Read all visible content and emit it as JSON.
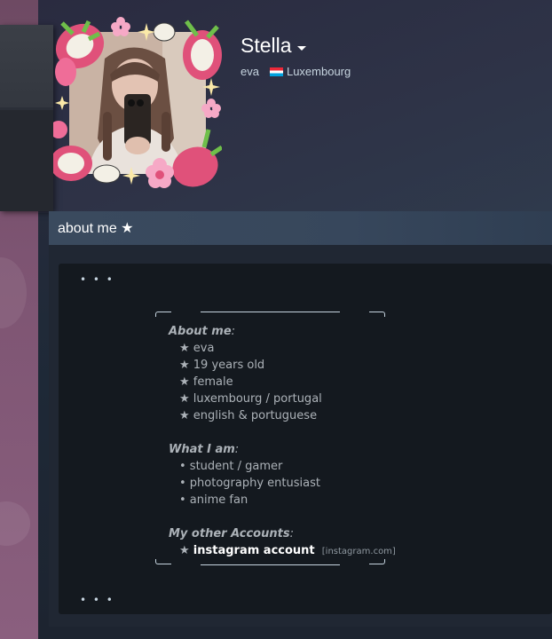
{
  "profile": {
    "name": "Stella",
    "real_name": "eva",
    "country": "Luxembourg",
    "country_flag_colors": [
      "#ed2939",
      "#ffffff",
      "#00a1de"
    ]
  },
  "about_section": {
    "title": "about me ★",
    "top_dots": "• • •",
    "bottom_dots": "• • •",
    "about_heading": "About me",
    "about_items": [
      "★ eva",
      "★ 19 years old",
      "★ female",
      "★ luxembourg / portugal",
      "★ english & portuguese"
    ],
    "what_heading": "What I am",
    "what_items": [
      "• student / gamer",
      "• photography entusiast",
      "• anime fan"
    ],
    "accounts_heading": "My other Accounts",
    "account_star": "★",
    "account_link": "instagram account",
    "account_domain": "[instagram.com]"
  },
  "colors": {
    "accent_pink": "#e0517a",
    "page_bg": "#1f2a36",
    "info_box_bg": "#14191f"
  },
  "icons": [
    "dragonfruit-frame-icon",
    "dropdown-caret-icon",
    "luxembourg-flag-icon"
  ]
}
